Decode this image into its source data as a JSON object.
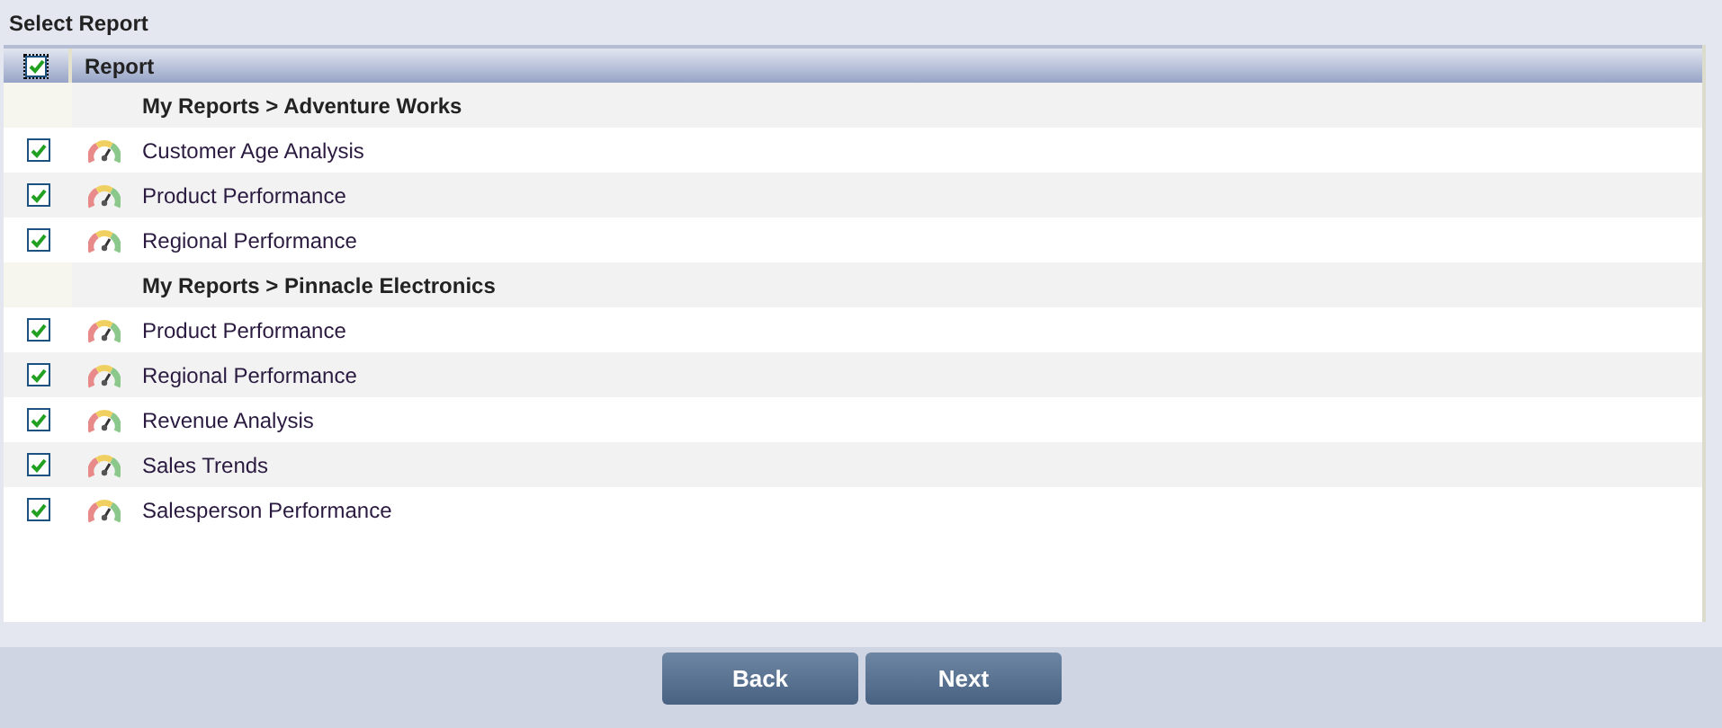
{
  "title": "Select Report",
  "table": {
    "select_all": {
      "checked": true
    },
    "columns": [
      "Report"
    ],
    "groups": [
      {
        "heading": "My Reports > Adventure Works",
        "rows": [
          {
            "name": "Customer Age Analysis",
            "checked": true
          },
          {
            "name": "Product Performance",
            "checked": true
          },
          {
            "name": "Regional Performance",
            "checked": true
          }
        ]
      },
      {
        "heading": "My Reports > Pinnacle Electronics",
        "rows": [
          {
            "name": "Product Performance",
            "checked": true
          },
          {
            "name": "Regional Performance",
            "checked": true
          },
          {
            "name": "Revenue Analysis",
            "checked": true
          },
          {
            "name": "Sales Trends",
            "checked": true
          },
          {
            "name": "Salesperson Performance",
            "checked": true
          }
        ]
      }
    ]
  },
  "buttons": [
    "Back",
    "Next"
  ]
}
